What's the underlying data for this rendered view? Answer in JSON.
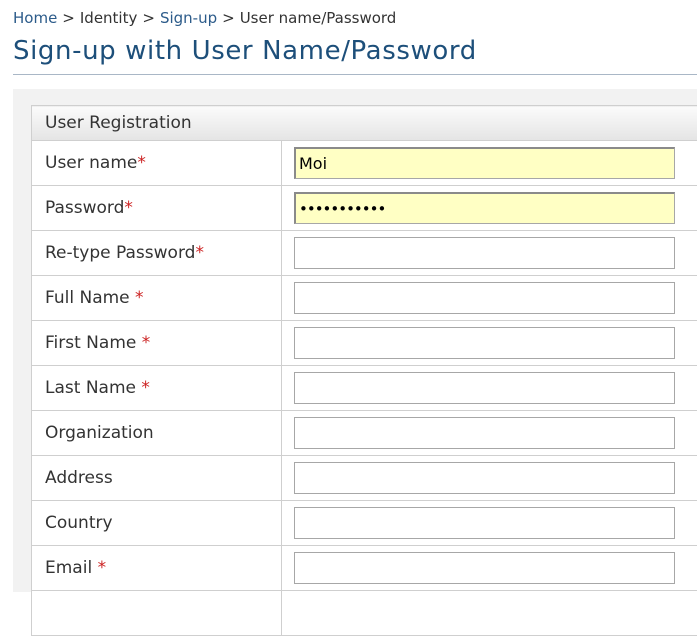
{
  "breadcrumb": {
    "home": "Home",
    "identity": "Identity",
    "signup": "Sign-up",
    "current": "User name/Password",
    "separator": ">"
  },
  "page_title": "Sign-up with User Name/Password",
  "form": {
    "header": "User Registration",
    "required_marker": "*",
    "fields": [
      {
        "label": "User name",
        "required": true,
        "value": "Moi"
      },
      {
        "label": "Password",
        "required": true,
        "value": "•••••••••••"
      },
      {
        "label": "Re-type Password",
        "required": true,
        "value": ""
      },
      {
        "label": "Full Name ",
        "required": true,
        "value": ""
      },
      {
        "label": "First Name ",
        "required": true,
        "value": ""
      },
      {
        "label": "Last Name ",
        "required": true,
        "value": ""
      },
      {
        "label": "Organization",
        "required": false,
        "value": ""
      },
      {
        "label": "Address",
        "required": false,
        "value": ""
      },
      {
        "label": "Country",
        "required": false,
        "value": ""
      },
      {
        "label": "Email ",
        "required": true,
        "value": ""
      }
    ]
  },
  "colors": {
    "link": "#2c5b8a",
    "title": "#1d4f7a",
    "required": "#cc2222",
    "active_input_bg": "#ffffc4"
  }
}
